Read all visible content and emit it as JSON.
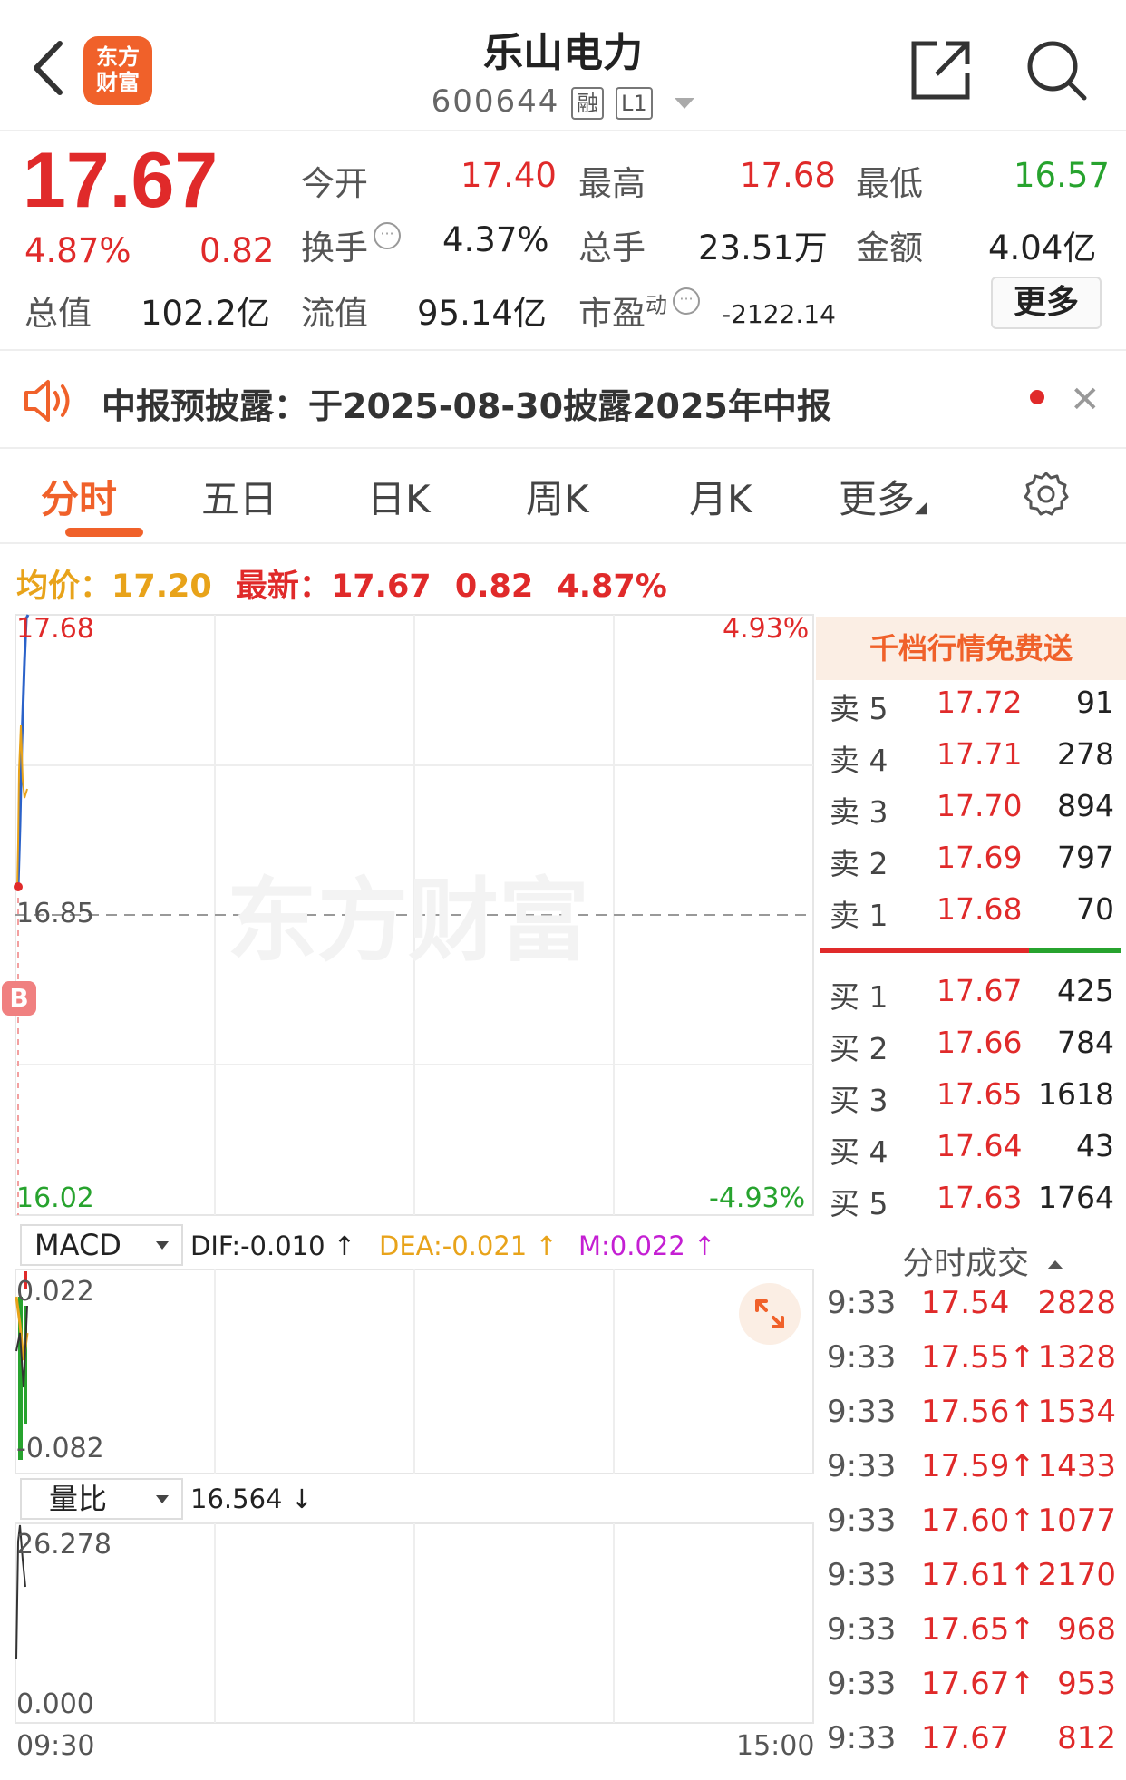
{
  "header": {
    "title": "乐山电力",
    "code": "600644",
    "tags": [
      "融",
      "L1"
    ],
    "logo_text": [
      "东方",
      "财富"
    ]
  },
  "quote": {
    "price": "17.67",
    "change_pct": "4.87%",
    "change": "0.82",
    "open_label": "今开",
    "open": "17.40",
    "high_label": "最高",
    "high": "17.68",
    "low_label": "最低",
    "low": "16.57",
    "turnover_label": "换手",
    "turnover": "4.37%",
    "volume_label": "总手",
    "volume": "23.51万",
    "amount_label": "金额",
    "amount": "4.04亿",
    "mktcap_label": "总值",
    "mktcap": "102.2亿",
    "float_label": "流值",
    "float": "95.14亿",
    "pe_label": "市盈",
    "pe_sup": "动",
    "pe": "-2122.14",
    "more": "更多"
  },
  "notice": {
    "text": "中报预披露：于2025-08-30披露2025年中报"
  },
  "tabs": [
    "分时",
    "五日",
    "日K",
    "周K",
    "月K",
    "更多"
  ],
  "avg_line": {
    "avg_label": "均价：",
    "avg": "17.20",
    "latest_label": "最新：",
    "latest": "17.67",
    "change": "0.82",
    "pct": "4.87%"
  },
  "chart": {
    "y_top": "17.68",
    "y_mid": "16.85",
    "y_bottom": "16.02",
    "pct_top": "4.93%",
    "pct_bottom": "-4.93%",
    "x_start": "09:30",
    "x_end": "15:00",
    "watermark": "东方财富",
    "marker": "B"
  },
  "chart_data": {
    "type": "line",
    "series": [],
    "ylim": [
      16.02,
      17.68
    ],
    "x": [
      "09:30",
      "15:00"
    ]
  },
  "orderbook": {
    "banner": "千档行情免费送",
    "asks": [
      {
        "label": "卖 5",
        "price": "17.72",
        "vol": "91"
      },
      {
        "label": "卖 4",
        "price": "17.71",
        "vol": "278"
      },
      {
        "label": "卖 3",
        "price": "17.70",
        "vol": "894"
      },
      {
        "label": "卖 2",
        "price": "17.69",
        "vol": "797"
      },
      {
        "label": "卖 1",
        "price": "17.68",
        "vol": "70"
      }
    ],
    "bids": [
      {
        "label": "买 1",
        "price": "17.67",
        "vol": "425"
      },
      {
        "label": "买 2",
        "price": "17.66",
        "vol": "784"
      },
      {
        "label": "买 3",
        "price": "17.65",
        "vol": "1618"
      },
      {
        "label": "买 4",
        "price": "17.64",
        "vol": "43"
      },
      {
        "label": "买 5",
        "price": "17.63",
        "vol": "1764"
      }
    ]
  },
  "ticks": {
    "title": "分时成交",
    "rows": [
      {
        "t": "9:33",
        "p": "17.54",
        "v": "2828"
      },
      {
        "t": "9:33",
        "p": "17.55↑",
        "v": "1328"
      },
      {
        "t": "9:33",
        "p": "17.56↑",
        "v": "1534"
      },
      {
        "t": "9:33",
        "p": "17.59↑",
        "v": "1433"
      },
      {
        "t": "9:33",
        "p": "17.60↑",
        "v": "1077"
      },
      {
        "t": "9:33",
        "p": "17.61↑",
        "v": "2170"
      },
      {
        "t": "9:33",
        "p": "17.65↑",
        "v": "968"
      },
      {
        "t": "9:33",
        "p": "17.67↑",
        "v": "953"
      },
      {
        "t": "9:33",
        "p": "17.67",
        "v": "812"
      }
    ]
  },
  "macd": {
    "selector": "MACD",
    "dif": "DIF:-0.010 ↑",
    "dea": "DEA:-0.021 ↑",
    "m": "M:0.022 ↑",
    "y_top": "0.022",
    "y_bottom": "-0.082"
  },
  "volratio": {
    "selector": "量比",
    "value": "16.564 ↓",
    "y_top": "26.278",
    "y_bottom": "0.000"
  },
  "colors": {
    "up": "#e02a2a",
    "down": "#27a32e",
    "accent": "#f0612a",
    "avg": "#e8a31a",
    "m": "#c41fd3"
  }
}
